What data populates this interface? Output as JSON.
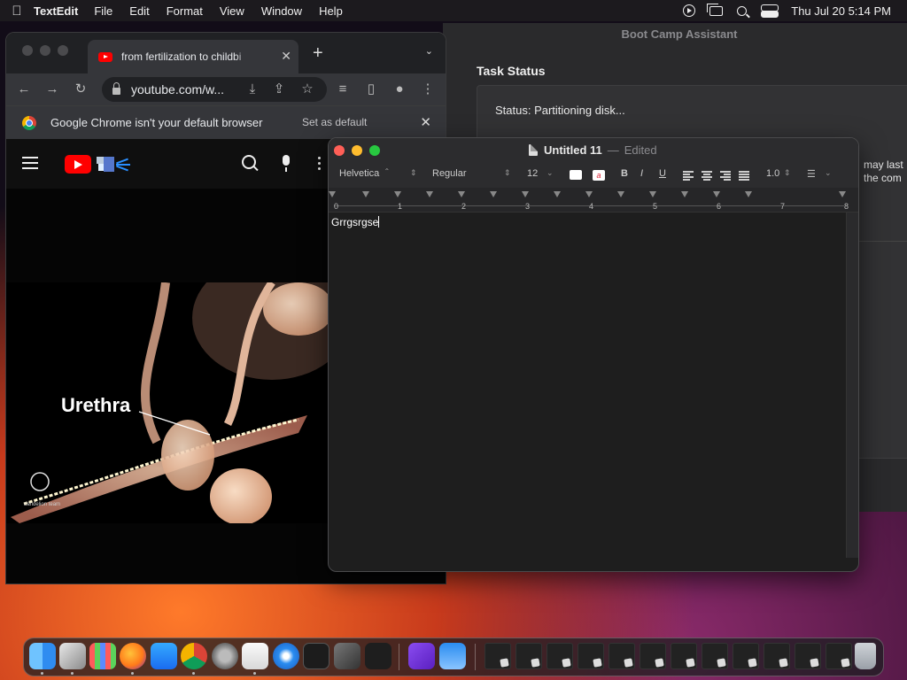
{
  "menubar": {
    "app_name": "TextEdit",
    "menus": [
      "File",
      "Edit",
      "Format",
      "View",
      "Window",
      "Help"
    ],
    "datetime": "Thu Jul 20  5:14 PM",
    "status_icons": [
      "screen-recording-icon",
      "window-switcher-icon",
      "spotlight-icon",
      "control-center-icon"
    ]
  },
  "bootcamp": {
    "window_title": "Boot Camp Assistant",
    "section_title": "Task Status",
    "status_text": "Status: Partitioning disk...",
    "partial_text_line1": "may last",
    "partial_text_line2": "the com"
  },
  "chrome": {
    "tab_title": "from fertilization to childbi",
    "url": "youtube.com/w...",
    "infobar_message": "Google Chrome isn't your default browser",
    "infobar_action": "Set as default",
    "video_label": "Urethra"
  },
  "textedit": {
    "doc_title": "Untitled 11",
    "doc_status": "Edited",
    "font_family": "Helvetica",
    "font_style": "Regular",
    "font_size": "12",
    "bold_label": "B",
    "italic_label": "I",
    "underline_label": "U",
    "line_spacing": "1.0",
    "ruler_numbers": [
      "0",
      "1",
      "2",
      "3",
      "4",
      "5",
      "6",
      "7",
      "8"
    ],
    "body_text": "Grrgsrgse"
  },
  "dock": {
    "apps": [
      "Finder",
      "Preview",
      "Launchpad",
      "Firefox",
      "App Store",
      "Chrome",
      "System Settings",
      "TextEdit",
      "Safari",
      "Terminal",
      "Instruments",
      "Visual Studio Code",
      "Visual Studio",
      "Weather"
    ],
    "minimized_count": 12,
    "trash_label": "Trash",
    "colors": {
      "finder": "#2f8cf0",
      "firefox": "#ff7a1a",
      "appstore": "#1a8cff",
      "vscode": "#23a8f2"
    }
  }
}
